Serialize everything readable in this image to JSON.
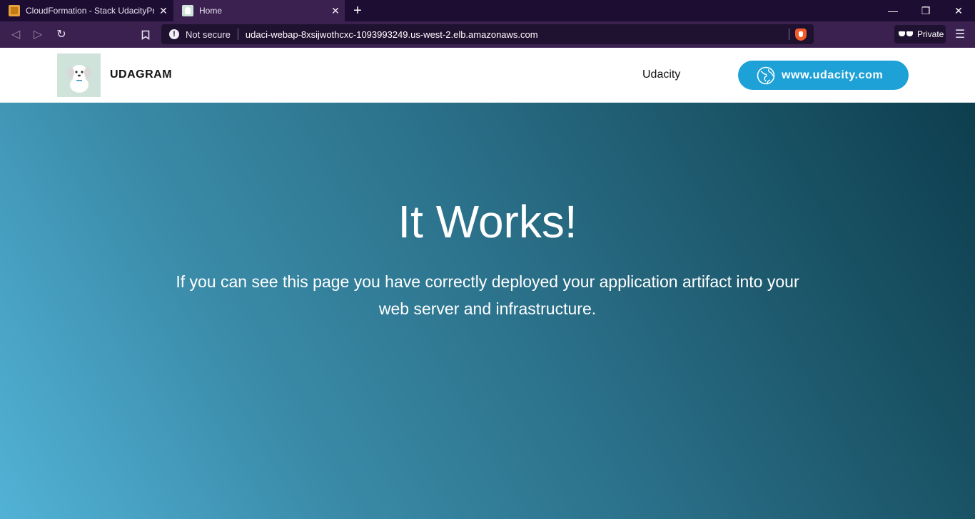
{
  "browser": {
    "tabs": [
      {
        "title": "CloudFormation - Stack UdacityProject",
        "favicon": "aws-cube-icon",
        "active": false
      },
      {
        "title": "Home",
        "favicon": "dog-favicon-icon",
        "active": true
      }
    ],
    "new_tab_symbol": "+",
    "close_symbol": "✕",
    "window_controls": {
      "minimize": "—",
      "restore": "❐",
      "close": "✕"
    },
    "address": {
      "security_label": "Not secure",
      "url": "udaci-webap-8xsijwothcxc-1093993249.us-west-2.elb.amazonaws.com"
    },
    "private_label": "Private",
    "colors": {
      "tabstrip": "#1e0d33",
      "toolbar": "#3a2150",
      "omnibox": "#1f1130"
    }
  },
  "site": {
    "brand": "UDAGRAM",
    "nav_link": "Udacity",
    "cta_label": "www.udacity.com",
    "hero": {
      "title": "It Works!",
      "text": "If you can see this page you have correctly deployed your application artifact into your web server and infrastructure."
    },
    "colors": {
      "accent": "#1da1d6",
      "hero_start": "#52b2d6",
      "hero_end": "#0d3e4e"
    }
  }
}
